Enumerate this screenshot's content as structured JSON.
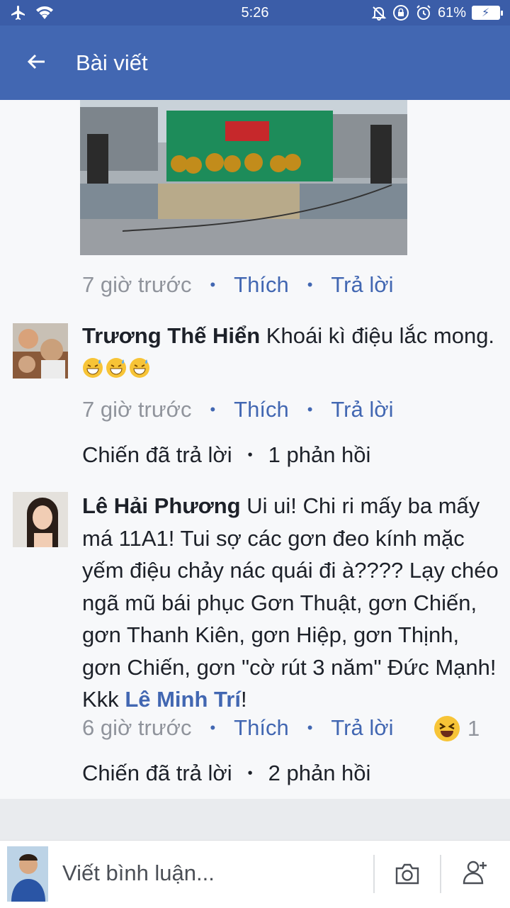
{
  "status_bar": {
    "time": "5:26",
    "battery": "61%",
    "icons": [
      "airplane-icon",
      "wifi-icon",
      "mute-icon",
      "lock-rotation-icon",
      "alarm-icon",
      "battery-icon"
    ]
  },
  "header": {
    "title": "Bài viết",
    "back_icon": "arrow-left-icon"
  },
  "comments": [
    {
      "time": "7 giờ trước",
      "like": "Thích",
      "reply": "Trả lời"
    },
    {
      "author": "Trương Thế Hiển",
      "text": "Khoái kì điệu lắc mong.",
      "emoji": "grinning-sweat-emoji",
      "time": "7 giờ trước",
      "like": "Thích",
      "reply": "Trả lời",
      "reply_author": "Chiến đã trả lời",
      "reply_count": "1 phản hồi"
    },
    {
      "author": "Lê Hải Phương",
      "text": "Ui ui! Chi ri mấy ba mấy má 11A1! Tui sợ các gơn đeo kính mặc yếm điệu chảy nác quái đi à???? Lạy chéo ngã mũ bái phục  Gơn Thuật, gơn Chiến, gơn Thanh Kiên, gơn Hiệp, gơn Thịnh, gơn Chiến, gơn \"cờ rút 3 năm\" Đức Mạnh! Kkk",
      "mention": "Lê Minh Trí",
      "after_mention": "!",
      "time": "6 giờ trước",
      "like": "Thích",
      "reply": "Trả lời",
      "reaction_count": "1",
      "reply_author": "Chiến đã trả lời",
      "reply_count": "2 phản hồi"
    }
  ],
  "composer": {
    "placeholder": "Viết bình luận...",
    "camera_icon": "camera-icon",
    "tag_icon": "add-person-icon"
  },
  "colors": {
    "brand": "#4267b2",
    "status_bar": "#3b5da8",
    "meta": "#90949c"
  }
}
